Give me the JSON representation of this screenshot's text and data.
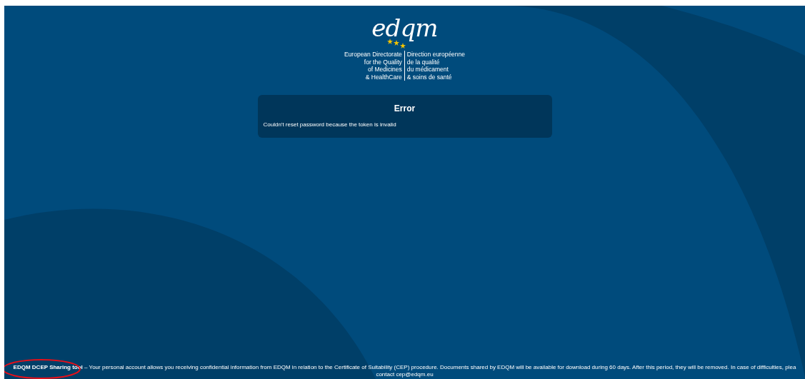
{
  "logo": {
    "wordmark": "edqm",
    "left_lines": [
      "European Directorate",
      "for the Quality",
      "of Medicines",
      "& HealthCare"
    ],
    "right_lines": [
      "Direction européenne",
      "de la qualité",
      "du médicament",
      "& soins de santé"
    ]
  },
  "error_card": {
    "title": "Error",
    "message": "Couldn't reset password because the token is invalid"
  },
  "footer": {
    "text": "**EDQM DCEP Sharing tool** – Your personal account allows you receiving confidential information from EDQM in relation to the Certificate of Suitability (CEP) procedure. Documents shared by EDQM will be available for download during 60 days. After this period, they will be removed. In case of difficulties, plea",
    "contact": "contact cep@edqm.eu",
    "highlighted": true
  }
}
